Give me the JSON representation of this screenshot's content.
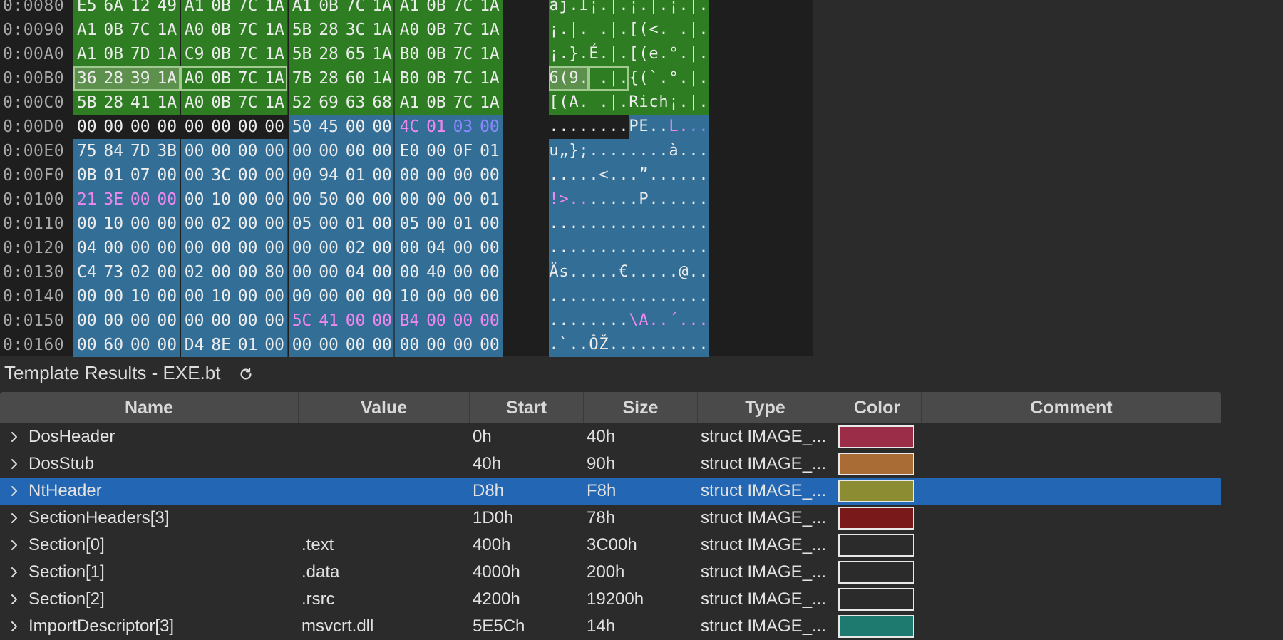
{
  "colors": {
    "green": "#2e7d22",
    "blue": "#336e96",
    "dark": "#1e1e1e",
    "magenta": "#ee88ee",
    "purple_blue": "#8a88ff",
    "selected_green": "#5d8f4d",
    "row_selected": "#2367b4"
  },
  "hex_rows": [
    {
      "addr": "0:0080",
      "bytes": [
        "E5",
        "6A",
        "12",
        "49",
        "A1",
        "0B",
        "7C",
        "1A",
        "A1",
        "0B",
        "7C",
        "1A",
        "A1",
        "0B",
        "7C",
        "1A"
      ],
      "ascii": [
        "å",
        "j",
        ".",
        "I",
        "¡",
        ".",
        "|",
        ".",
        "¡",
        ".",
        "|",
        ".",
        "¡",
        ".",
        "|",
        "."
      ],
      "bg": [
        "g",
        "g",
        "g",
        "g",
        "g",
        "g",
        "g",
        "g",
        "g",
        "g",
        "g",
        "g",
        "g",
        "g",
        "g",
        "g"
      ],
      "fg": []
    },
    {
      "addr": "0:0090",
      "bytes": [
        "A1",
        "0B",
        "7C",
        "1A",
        "A0",
        "0B",
        "7C",
        "1A",
        "5B",
        "28",
        "3C",
        "1A",
        "A0",
        "0B",
        "7C",
        "1A"
      ],
      "ascii": [
        "¡",
        ".",
        "|",
        ".",
        " ",
        ".",
        "|",
        ".",
        "[",
        "(",
        "<",
        ".",
        " ",
        ".",
        "|",
        "."
      ],
      "bg": [
        "g",
        "g",
        "g",
        "g",
        "g",
        "g",
        "g",
        "g",
        "g",
        "g",
        "g",
        "g",
        "g",
        "g",
        "g",
        "g"
      ],
      "fg": []
    },
    {
      "addr": "0:00A0",
      "bytes": [
        "A1",
        "0B",
        "7D",
        "1A",
        "C9",
        "0B",
        "7C",
        "1A",
        "5B",
        "28",
        "65",
        "1A",
        "B0",
        "0B",
        "7C",
        "1A"
      ],
      "ascii": [
        "¡",
        ".",
        "}",
        ".",
        "É",
        ".",
        "|",
        ".",
        "[",
        "(",
        "e",
        ".",
        "°",
        ".",
        "|",
        "."
      ],
      "bg": [
        "g",
        "g",
        "g",
        "g",
        "g",
        "g",
        "g",
        "g",
        "g",
        "g",
        "g",
        "g",
        "g",
        "g",
        "g",
        "g"
      ],
      "fg": []
    },
    {
      "addr": "0:00B0",
      "bytes": [
        "36",
        "28",
        "39",
        "1A",
        "A0",
        "0B",
        "7C",
        "1A",
        "7B",
        "28",
        "60",
        "1A",
        "B0",
        "0B",
        "7C",
        "1A"
      ],
      "ascii": [
        "6",
        "(",
        "9",
        ".",
        " ",
        ".",
        "|",
        ".",
        "{",
        "(",
        "`",
        ".",
        "°",
        ".",
        "|",
        "."
      ],
      "bg": [
        "s",
        "s",
        "s",
        "s",
        "g",
        "g",
        "g",
        "g",
        "g",
        "g",
        "g",
        "g",
        "g",
        "g",
        "g",
        "g"
      ],
      "fg": []
    },
    {
      "addr": "0:00C0",
      "bytes": [
        "5B",
        "28",
        "41",
        "1A",
        "A0",
        "0B",
        "7C",
        "1A",
        "52",
        "69",
        "63",
        "68",
        "A1",
        "0B",
        "7C",
        "1A"
      ],
      "ascii": [
        "[",
        "(",
        "A",
        ".",
        " ",
        ".",
        "|",
        ".",
        "R",
        "i",
        "c",
        "h",
        "¡",
        ".",
        "|",
        "."
      ],
      "bg": [
        "g",
        "g",
        "g",
        "g",
        "g",
        "g",
        "g",
        "g",
        "g",
        "g",
        "g",
        "g",
        "g",
        "g",
        "g",
        "g"
      ],
      "fg": []
    },
    {
      "addr": "0:00D0",
      "bytes": [
        "00",
        "00",
        "00",
        "00",
        "00",
        "00",
        "00",
        "00",
        "50",
        "45",
        "00",
        "00",
        "4C",
        "01",
        "03",
        "00"
      ],
      "ascii": [
        ".",
        ".",
        ".",
        ".",
        ".",
        ".",
        ".",
        ".",
        "P",
        "E",
        ".",
        ".",
        "L",
        ".",
        ".",
        "."
      ],
      "bg": [
        "d",
        "d",
        "d",
        "d",
        "d",
        "d",
        "d",
        "d",
        "b",
        "b",
        "b",
        "b",
        "b",
        "b",
        "b",
        "b"
      ],
      "fg": [
        "",
        "",
        "",
        "",
        "",
        "",
        "",
        "",
        "",
        "",
        "",
        "",
        "m",
        "m",
        "p",
        "p"
      ]
    },
    {
      "addr": "0:00E0",
      "bytes": [
        "75",
        "84",
        "7D",
        "3B",
        "00",
        "00",
        "00",
        "00",
        "00",
        "00",
        "00",
        "00",
        "E0",
        "00",
        "0F",
        "01"
      ],
      "ascii": [
        "u",
        "„",
        "}",
        ";",
        ".",
        ".",
        ".",
        ".",
        ".",
        ".",
        ".",
        ".",
        "à",
        ".",
        ".",
        "."
      ],
      "bg": [
        "b",
        "b",
        "b",
        "b",
        "b",
        "b",
        "b",
        "b",
        "b",
        "b",
        "b",
        "b",
        "b",
        "b",
        "b",
        "b"
      ],
      "fg": []
    },
    {
      "addr": "0:00F0",
      "bytes": [
        "0B",
        "01",
        "07",
        "00",
        "00",
        "3C",
        "00",
        "00",
        "00",
        "94",
        "01",
        "00",
        "00",
        "00",
        "00",
        "00"
      ],
      "ascii": [
        ".",
        ".",
        ".",
        ".",
        ".",
        "<",
        ".",
        ".",
        ".",
        "”",
        ".",
        ".",
        ".",
        ".",
        ".",
        "."
      ],
      "bg": [
        "b",
        "b",
        "b",
        "b",
        "b",
        "b",
        "b",
        "b",
        "b",
        "b",
        "b",
        "b",
        "b",
        "b",
        "b",
        "b"
      ],
      "fg": []
    },
    {
      "addr": "0:0100",
      "bytes": [
        "21",
        "3E",
        "00",
        "00",
        "00",
        "10",
        "00",
        "00",
        "00",
        "50",
        "00",
        "00",
        "00",
        "00",
        "00",
        "01"
      ],
      "ascii": [
        "!",
        ">",
        ".",
        ".",
        ".",
        ".",
        ".",
        ".",
        ".",
        "P",
        ".",
        ".",
        ".",
        ".",
        ".",
        "."
      ],
      "bg": [
        "b",
        "b",
        "b",
        "b",
        "b",
        "b",
        "b",
        "b",
        "b",
        "b",
        "b",
        "b",
        "b",
        "b",
        "b",
        "b"
      ],
      "fg": [
        "m",
        "m",
        "m",
        "m"
      ]
    },
    {
      "addr": "0:0110",
      "bytes": [
        "00",
        "10",
        "00",
        "00",
        "00",
        "02",
        "00",
        "00",
        "05",
        "00",
        "01",
        "00",
        "05",
        "00",
        "01",
        "00"
      ],
      "ascii": [
        ".",
        ".",
        ".",
        ".",
        ".",
        ".",
        ".",
        ".",
        ".",
        ".",
        ".",
        ".",
        ".",
        ".",
        ".",
        "."
      ],
      "bg": [
        "b",
        "b",
        "b",
        "b",
        "b",
        "b",
        "b",
        "b",
        "b",
        "b",
        "b",
        "b",
        "b",
        "b",
        "b",
        "b"
      ],
      "fg": []
    },
    {
      "addr": "0:0120",
      "bytes": [
        "04",
        "00",
        "00",
        "00",
        "00",
        "00",
        "00",
        "00",
        "00",
        "00",
        "02",
        "00",
        "00",
        "04",
        "00",
        "00"
      ],
      "ascii": [
        ".",
        ".",
        ".",
        ".",
        ".",
        ".",
        ".",
        ".",
        ".",
        ".",
        ".",
        ".",
        ".",
        ".",
        ".",
        "."
      ],
      "bg": [
        "b",
        "b",
        "b",
        "b",
        "b",
        "b",
        "b",
        "b",
        "b",
        "b",
        "b",
        "b",
        "b",
        "b",
        "b",
        "b"
      ],
      "fg": []
    },
    {
      "addr": "0:0130",
      "bytes": [
        "C4",
        "73",
        "02",
        "00",
        "02",
        "00",
        "00",
        "80",
        "00",
        "00",
        "04",
        "00",
        "00",
        "40",
        "00",
        "00"
      ],
      "ascii": [
        "Ä",
        "s",
        ".",
        ".",
        ".",
        ".",
        ".",
        "€",
        ".",
        ".",
        ".",
        ".",
        ".",
        "@",
        ".",
        "."
      ],
      "bg": [
        "b",
        "b",
        "b",
        "b",
        "b",
        "b",
        "b",
        "b",
        "b",
        "b",
        "b",
        "b",
        "b",
        "b",
        "b",
        "b"
      ],
      "fg": []
    },
    {
      "addr": "0:0140",
      "bytes": [
        "00",
        "00",
        "10",
        "00",
        "00",
        "10",
        "00",
        "00",
        "00",
        "00",
        "00",
        "00",
        "10",
        "00",
        "00",
        "00"
      ],
      "ascii": [
        ".",
        ".",
        ".",
        ".",
        ".",
        ".",
        ".",
        ".",
        ".",
        ".",
        ".",
        ".",
        ".",
        ".",
        ".",
        "."
      ],
      "bg": [
        "b",
        "b",
        "b",
        "b",
        "b",
        "b",
        "b",
        "b",
        "b",
        "b",
        "b",
        "b",
        "b",
        "b",
        "b",
        "b"
      ],
      "fg": []
    },
    {
      "addr": "0:0150",
      "bytes": [
        "00",
        "00",
        "00",
        "00",
        "00",
        "00",
        "00",
        "00",
        "5C",
        "41",
        "00",
        "00",
        "B4",
        "00",
        "00",
        "00"
      ],
      "ascii": [
        ".",
        ".",
        ".",
        ".",
        ".",
        ".",
        ".",
        ".",
        "\\",
        "A",
        ".",
        ".",
        "´",
        ".",
        ".",
        "."
      ],
      "bg": [
        "b",
        "b",
        "b",
        "b",
        "b",
        "b",
        "b",
        "b",
        "b",
        "b",
        "b",
        "b",
        "b",
        "b",
        "b",
        "b"
      ],
      "fg": [
        "",
        "",
        "",
        "",
        "",
        "",
        "",
        "",
        "m",
        "m",
        "m",
        "m",
        "m",
        "m",
        "m",
        "m"
      ]
    },
    {
      "addr": "0:0160",
      "bytes": [
        "00",
        "60",
        "00",
        "00",
        "D4",
        "8E",
        "01",
        "00",
        "00",
        "00",
        "00",
        "00",
        "00",
        "00",
        "00",
        "00"
      ],
      "ascii": [
        ".",
        "`",
        ".",
        ".",
        "Ô",
        "Ž",
        ".",
        ".",
        ".",
        ".",
        ".",
        ".",
        ".",
        ".",
        ".",
        "."
      ],
      "bg": [
        "b",
        "b",
        "b",
        "b",
        "b",
        "b",
        "b",
        "b",
        "b",
        "b",
        "b",
        "b",
        "b",
        "b",
        "b",
        "b"
      ],
      "fg": []
    }
  ],
  "results": {
    "title": "Template Results - EXE.bt",
    "refresh_icon": "refresh-icon",
    "columns": [
      "Name",
      "Value",
      "Start",
      "Size",
      "Type",
      "Color",
      "Comment"
    ],
    "rows": [
      {
        "name": "DosHeader",
        "value": "",
        "start": "0h",
        "size": "40h",
        "type": "struct IMAGE_...",
        "color": "#9b2d48",
        "selected": false
      },
      {
        "name": "DosStub",
        "value": "",
        "start": "40h",
        "size": "90h",
        "type": "struct IMAGE_...",
        "color": "#a86c34",
        "selected": false
      },
      {
        "name": "NtHeader",
        "value": "",
        "start": "D8h",
        "size": "F8h",
        "type": "struct IMAGE_...",
        "color": "#8c8c33",
        "selected": true
      },
      {
        "name": "SectionHeaders[3]",
        "value": "",
        "start": "1D0h",
        "size": "78h",
        "type": "struct IMAGE_...",
        "color": "#7a1919",
        "selected": false
      },
      {
        "name": "Section[0]",
        "value": ".text",
        "start": "400h",
        "size": "3C00h",
        "type": "struct IMAGE_...",
        "color": "#2b2b2b",
        "selected": false
      },
      {
        "name": "Section[1]",
        "value": ".data",
        "start": "4000h",
        "size": "200h",
        "type": "struct IMAGE_...",
        "color": "#2b2b2b",
        "selected": false
      },
      {
        "name": "Section[2]",
        "value": ".rsrc",
        "start": "4200h",
        "size": "19200h",
        "type": "struct IMAGE_...",
        "color": "#2b2b2b",
        "selected": false
      },
      {
        "name": "ImportDescriptor[3]",
        "value": "msvcrt.dll",
        "start": "5E5Ch",
        "size": "14h",
        "type": "struct IMAGE_...",
        "color": "#1e7a6e",
        "selected": false
      }
    ]
  }
}
